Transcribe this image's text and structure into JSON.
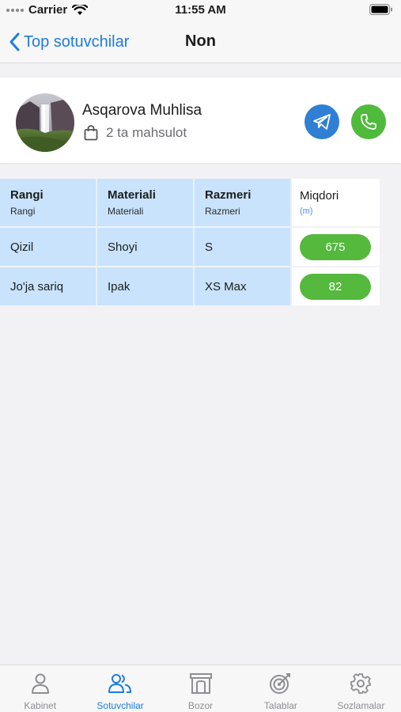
{
  "status_bar": {
    "carrier": "Carrier",
    "time": "11:55 AM"
  },
  "nav": {
    "back_label": "Top sotuvchilar",
    "title": "Non"
  },
  "profile": {
    "name": "Asqarova Muhlisa",
    "products": "2 ta mahsulot"
  },
  "table": {
    "headers": [
      {
        "title": "Rangi",
        "sub": "Rangi"
      },
      {
        "title": "Materiali",
        "sub": "Materiali"
      },
      {
        "title": "Razmeri",
        "sub": "Razmeri"
      },
      {
        "title": "Miqdori",
        "sub": "(m)"
      }
    ],
    "rows": [
      {
        "color": "Qizil",
        "material": "Shoyi",
        "size": "S",
        "qty": "675"
      },
      {
        "color": "Jo'ja sariq",
        "material": "Ipak",
        "size": "XS Max",
        "qty": "82"
      }
    ]
  },
  "tabs": [
    {
      "label": "Kabinet",
      "icon": "person-icon"
    },
    {
      "label": "Sotuvchilar",
      "icon": "users-icon",
      "active": true
    },
    {
      "label": "Bozor",
      "icon": "store-icon"
    },
    {
      "label": "Talablar",
      "icon": "target-icon"
    },
    {
      "label": "Sozlamalar",
      "icon": "gear-icon"
    }
  ],
  "colors": {
    "accent": "#1e7be0",
    "telegram": "#2f7fd4",
    "phone": "#4fba3c",
    "quantity_pill": "#54b93d",
    "table_cell": "#c8e3fb"
  }
}
